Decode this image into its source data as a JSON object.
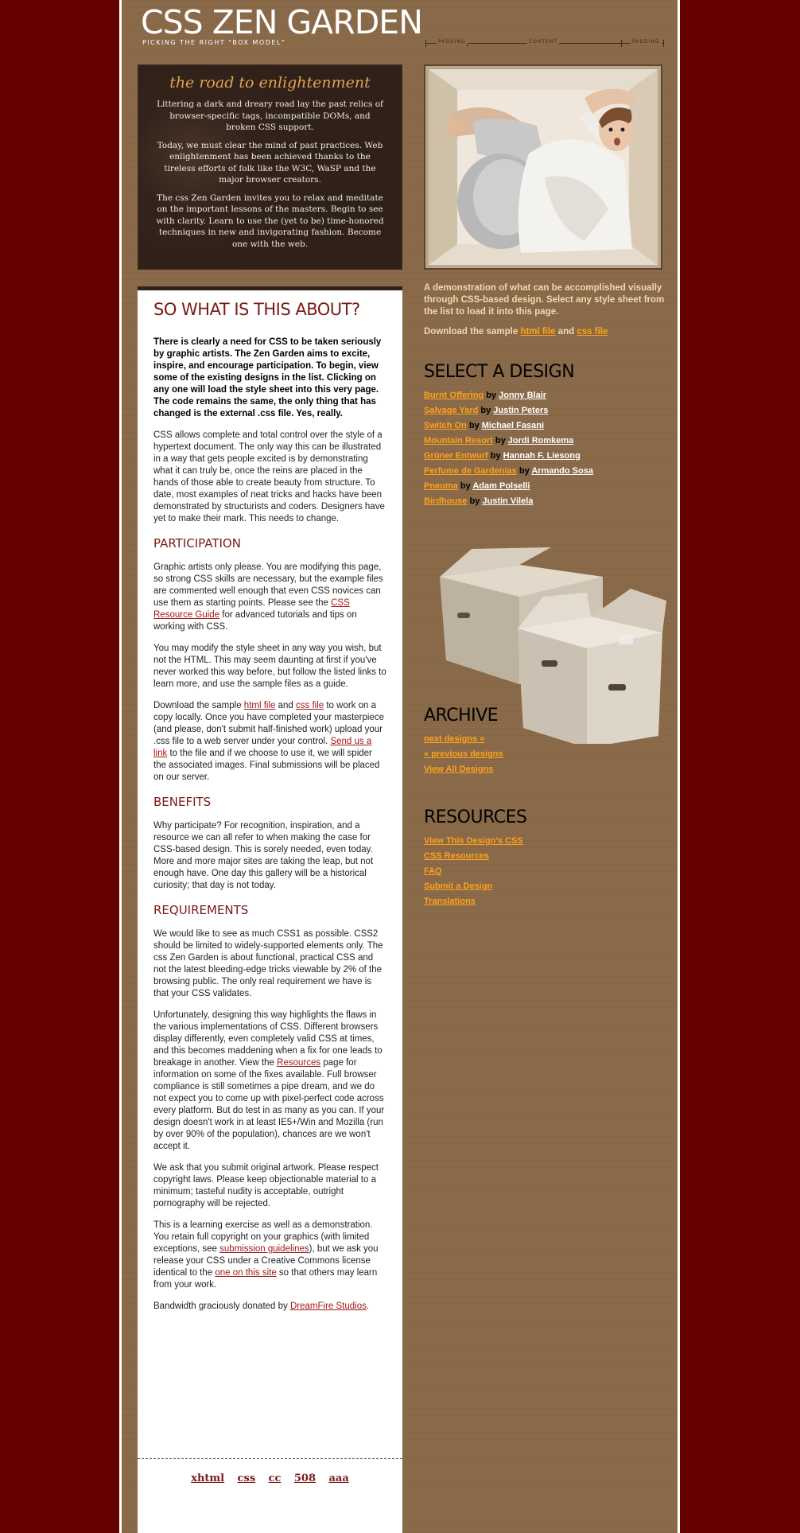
{
  "header": {
    "title": "CSS ZEN GARDEN",
    "subtitle": "PICKING THE RIGHT \"BOX MODEL\"",
    "diagram": {
      "padding_left": "PADDING",
      "content": "CONTENT",
      "padding_right": "PADDING"
    }
  },
  "intro": {
    "title": "the road to enlightenment",
    "p1": "Littering a dark and dreary road lay the past relics of browser-specific tags, incompatible DOMs, and broken CSS support.",
    "p2": "Today, we must clear the mind of past practices. Web enlightenment has been achieved thanks to the tireless efforts of folk like the W3C, WaSP and the major browser creators.",
    "p3": "The css Zen Garden invites you to relax and meditate on the important lessons of the masters. Begin to see with clarity. Learn to use the (yet to be) time-honored techniques in new and invigorating fashion. Become one with the web."
  },
  "main": {
    "title": "SO WHAT IS THIS ABOUT?",
    "lead": "There is clearly a need for CSS to be taken seriously by graphic artists. The Zen Garden aims to excite, inspire, and encourage participation. To begin, view some of the existing designs in the list. Clicking on any one will load the style sheet into this very page. The code remains the same, the only thing that has changed is the external .css file. Yes, really.",
    "p2": "CSS allows complete and total control over the style of a hypertext document. The only way this can be illustrated in a way that gets people excited is by demonstrating what it can truly be, once the reins are placed in the hands of those able to create beauty from structure. To date, most examples of neat tricks and hacks have been demonstrated by structurists and coders. Designers have yet to make their mark. This needs to change.",
    "participation_title": "PARTICIPATION",
    "part_p1_a": "Graphic artists only please. You are modifying this page, so strong CSS skills are necessary, but the example files are commented well enough that even CSS novices can use them as starting points. Please see the ",
    "part_p1_link": "CSS Resource Guide",
    "part_p1_b": " for advanced tutorials and tips on working with CSS.",
    "part_p2": "You may modify the style sheet in any way you wish, but not the HTML. This may seem daunting at first if you've never worked this way before, but follow the listed links to learn more, and use the sample files as a guide.",
    "part_p3_a": "Download the sample ",
    "part_p3_html": "html file",
    "part_p3_and": " and ",
    "part_p3_css": "css file",
    "part_p3_b": " to work on a copy locally. Once you have completed your masterpiece (and please, don't submit half-finished work) upload your .css file to a web server under your control. ",
    "part_p3_send": "Send us a link",
    "part_p3_c": " to the file and if we choose to use it, we will spider the associated images. Final submissions will be placed on our server.",
    "benefits_title": "BENEFITS",
    "benefits_p": "Why participate? For recognition, inspiration, and a resource we can all refer to when making the case for CSS-based design. This is sorely needed, even today. More and more major sites are taking the leap, but not enough have. One day this gallery will be a historical curiosity; that day is not today.",
    "requirements_title": "REQUIREMENTS",
    "req_p1": "We would like to see as much CSS1 as possible. CSS2 should be limited to widely-supported elements only. The css Zen Garden is about functional, practical CSS and not the latest bleeding-edge tricks viewable by 2% of the browsing public. The only real requirement we have is that your CSS validates.",
    "req_p2_a": "Unfortunately, designing this way highlights the flaws in the various implementations of CSS. Different browsers display differently, even completely valid CSS at times, and this becomes maddening when a fix for one leads to breakage in another. View the ",
    "req_p2_link": "Resources",
    "req_p2_b": " page for information on some of the fixes available. Full browser compliance is still sometimes a pipe dream, and we do not expect you to come up with pixel-perfect code across every platform. But do test in as many as you can. If your design doesn't work in at least IE5+/Win and Mozilla (run by over 90% of the population), chances are we won't accept it.",
    "req_p3": "We ask that you submit original artwork. Please respect copyright laws. Please keep objectionable material to a minimum; tasteful nudity is acceptable, outright pornography will be rejected.",
    "req_p4_a": "This is a learning exercise as well as a demonstration. You retain full copyright on your graphics (with limited exceptions, see ",
    "req_p4_link1": "submission guidelines",
    "req_p4_b": "), but we ask you release your CSS under a Creative Commons license identical to the ",
    "req_p4_link2": "one on this site",
    "req_p4_c": " so that others may learn from your work.",
    "bandwidth_a": "Bandwidth graciously donated by ",
    "bandwidth_link": "DreamFire Studios",
    "bandwidth_b": ".",
    "footer_links": [
      "xhtml",
      "css",
      "cc",
      "508",
      "aaa"
    ]
  },
  "sidebar": {
    "intro": "A demonstration of what can be accomplished visually through CSS-based design. Select any style sheet from the list to load it into this page.",
    "download_a": "Download the sample ",
    "download_html": "html file",
    "download_and": " and ",
    "download_css": "css file",
    "select_title": "SELECT A DESIGN",
    "by": "by",
    "designs": [
      {
        "name": "Burnt Offering",
        "author": "Jonny Blair"
      },
      {
        "name": "Salvage Yard",
        "author": "Justin Peters"
      },
      {
        "name": "Switch On",
        "author": "Michael Fasani"
      },
      {
        "name": "Mountain Resort",
        "author": "Jordi Romkema"
      },
      {
        "name": "Grüner Entwurf",
        "author": "Hannah F. Liesong"
      },
      {
        "name": "Perfume de Gardenias",
        "author": "Armando Sosa"
      },
      {
        "name": "Pneuma",
        "author": "Adam Polselli"
      },
      {
        "name": "Birdhouse",
        "author": "Justin Vilela"
      }
    ],
    "archive_title": "ARCHIVE",
    "archive_links": [
      "next designs »",
      "« previous designs",
      "View All Designs"
    ],
    "resources_title": "RESOURCES",
    "resources_links": [
      "View This Design's CSS",
      "CSS Resources",
      "FAQ",
      "Submit a Design",
      "Translations"
    ]
  },
  "colors": {
    "page_background": "#660000",
    "content_background": "#8b6b4a",
    "accent_orange": "#ffa21a",
    "heading_red": "#7a1a1a"
  }
}
